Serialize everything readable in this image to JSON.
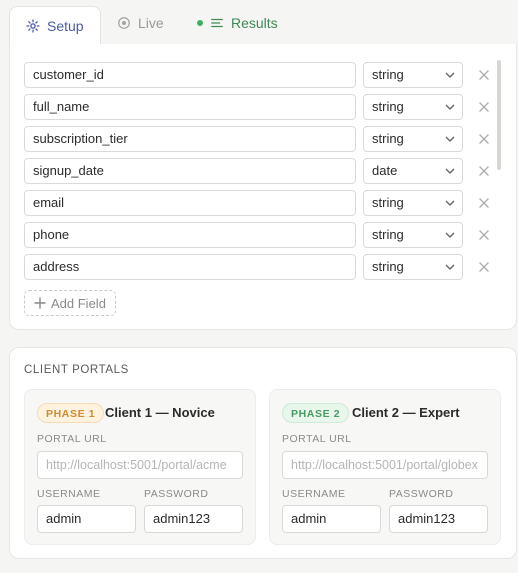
{
  "tabs": [
    {
      "label": "Setup",
      "icon": "gear-icon",
      "active": true
    },
    {
      "label": "Live",
      "icon": "record-icon",
      "active": false
    },
    {
      "label": "Results",
      "icon": "list-icon",
      "active": false
    }
  ],
  "fields": [
    {
      "name": "customer_id",
      "type": "string"
    },
    {
      "name": "full_name",
      "type": "string"
    },
    {
      "name": "subscription_tier",
      "type": "string"
    },
    {
      "name": "signup_date",
      "type": "date"
    },
    {
      "name": "email",
      "type": "string"
    },
    {
      "name": "phone",
      "type": "string"
    },
    {
      "name": "address",
      "type": "string"
    }
  ],
  "add_field_label": "Add Field",
  "portals": {
    "title": "CLIENT PORTALS",
    "clients": [
      {
        "phase": "PHASE 1",
        "name": "Client 1 — Novice",
        "url_label": "PORTAL URL",
        "url_placeholder": "http://localhost:5001/portal/acme",
        "username_label": "USERNAME",
        "username": "admin",
        "password_label": "PASSWORD",
        "password": "admin123"
      },
      {
        "phase": "PHASE 2",
        "name": "Client 2 — Expert",
        "url_label": "PORTAL URL",
        "url_placeholder": "http://localhost:5001/portal/globex",
        "username_label": "USERNAME",
        "username": "admin",
        "password_label": "PASSWORD",
        "password": "admin123"
      }
    ]
  },
  "colors": {
    "accent": "#4a5aa8",
    "results_green": "#3f8a55",
    "phase1": "#d18a2c",
    "phase2": "#4a9a63"
  }
}
